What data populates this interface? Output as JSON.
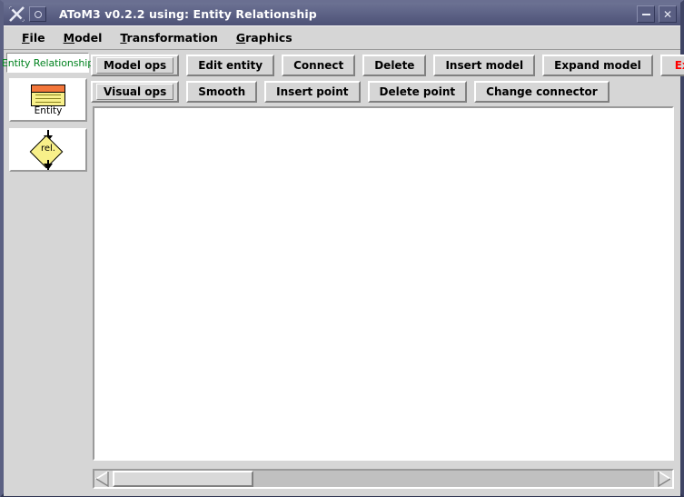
{
  "window": {
    "title": "AToM3 v0.2.2 using: Entity Relationship",
    "logo_icon": "x11-logo-icon",
    "window_menu_icon": "window-menu-icon",
    "minimize_label": "minimize",
    "close_label": "✕",
    "accent_titlebar": "#5b6084"
  },
  "menubar": {
    "items": [
      {
        "label": "File",
        "mnemonic": "F",
        "rest": "ile"
      },
      {
        "label": "Model",
        "mnemonic": "M",
        "rest": "odel"
      },
      {
        "label": "Transformation",
        "mnemonic": "T",
        "rest": "ransformation"
      },
      {
        "label": "Graphics",
        "mnemonic": "G",
        "rest": "raphics"
      }
    ]
  },
  "toolbar": {
    "row1": [
      {
        "label": "Model ops",
        "style": "menubutton",
        "name": "model-ops-button"
      },
      {
        "label": "Edit entity",
        "style": "button",
        "name": "edit-entity-button"
      },
      {
        "label": "Connect",
        "style": "button",
        "name": "connect-button"
      },
      {
        "label": "Delete",
        "style": "button",
        "name": "delete-button"
      },
      {
        "label": "Insert model",
        "style": "button",
        "name": "insert-model-button"
      },
      {
        "label": "Expand model",
        "style": "button",
        "name": "expand-model-button"
      }
    ],
    "exit": {
      "label": "Exit",
      "color": "#ff0000",
      "name": "exit-button"
    },
    "row2": [
      {
        "label": "Visual ops",
        "style": "menubutton",
        "name": "visual-ops-button"
      },
      {
        "label": "Smooth",
        "style": "button",
        "name": "smooth-button"
      },
      {
        "label": "Insert point",
        "style": "button",
        "name": "insert-point-button"
      },
      {
        "label": "Delete point",
        "style": "button",
        "name": "delete-point-button"
      },
      {
        "label": "Change connector",
        "style": "button",
        "name": "change-connector-button"
      }
    ]
  },
  "sidebar": {
    "formalism_label": "Entity Relationship",
    "formalism_label_color": "#00821e",
    "palette": [
      {
        "name": "palette-item-entity",
        "icon": "entity-table-icon",
        "caption": "Entity",
        "header_color": "#f3763a",
        "body_color": "#f8f08a"
      },
      {
        "name": "palette-item-relationship",
        "icon": "relationship-diamond-icon",
        "caption": "rel.",
        "body_color": "#f8f08a"
      }
    ]
  },
  "canvas": {
    "background": "#ffffff",
    "content": ""
  },
  "scrollbar": {
    "left_arrow_icon": "scroll-left-arrow-icon",
    "right_arrow_icon": "scroll-right-arrow-icon",
    "orientation": "horizontal"
  }
}
